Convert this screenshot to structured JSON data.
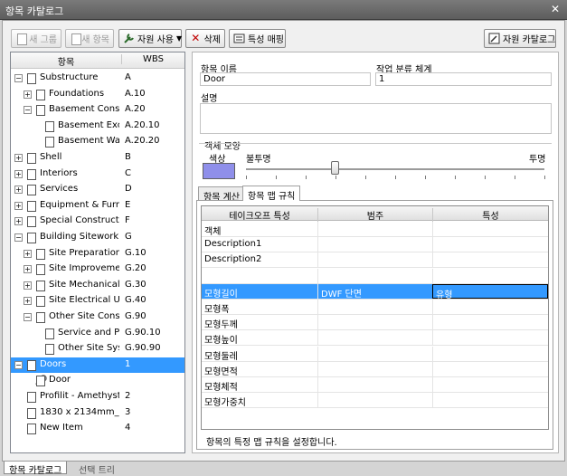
{
  "window": {
    "title": "항목 카탈로그",
    "close_glyph": "✕"
  },
  "toolbar": {
    "new_group": "새 그룹",
    "new_item": "새 항목",
    "use_resource": "자원 사용",
    "delete": "삭제",
    "property_mapping": "특성 매핑",
    "resource_catalog": "자원 카탈로그"
  },
  "tree": {
    "col_item": "항목",
    "col_wbs": "WBS",
    "rows": [
      {
        "label": "Substructure",
        "wbs": "A"
      },
      {
        "label": "Foundations",
        "wbs": "A.10"
      },
      {
        "label": "Basement Constr...",
        "wbs": "A.20"
      },
      {
        "label": "Basement Exca...",
        "wbs": "A.20.10"
      },
      {
        "label": "Basement Walls",
        "wbs": "A.20.20"
      },
      {
        "label": "Shell",
        "wbs": "B"
      },
      {
        "label": "Interiors",
        "wbs": "C"
      },
      {
        "label": "Services",
        "wbs": "D"
      },
      {
        "label": "Equipment & Furni...",
        "wbs": "E"
      },
      {
        "label": "Special Constructio...",
        "wbs": "F"
      },
      {
        "label": "Building Sitework",
        "wbs": "G"
      },
      {
        "label": "Site Preparation",
        "wbs": "G.10"
      },
      {
        "label": "Site Improvements",
        "wbs": "G.20"
      },
      {
        "label": "Site Mechanical...",
        "wbs": "G.30"
      },
      {
        "label": "Site Electrical Uti...",
        "wbs": "G.40"
      },
      {
        "label": "Other Site Const...",
        "wbs": "G.90"
      },
      {
        "label": "Service and Pe...",
        "wbs": "G.90.10"
      },
      {
        "label": "Other Site Syst...",
        "wbs": "G.90.90"
      },
      {
        "label": "Doors",
        "wbs": "1"
      },
      {
        "label": "Door",
        "wbs": ""
      },
      {
        "label": "Profilit - Amethyst",
        "wbs": "2"
      },
      {
        "label": "1830 x 2134mm_M...",
        "wbs": "3"
      },
      {
        "label": "New Item",
        "wbs": "4"
      }
    ]
  },
  "details": {
    "item_name_label": "항목 이름",
    "item_name_value": "Door",
    "wbs_label": "작업 분류 체계",
    "wbs_value": "1",
    "description_label": "설명",
    "description_value": "",
    "appearance_label": "객체 모양",
    "color_label": "색상",
    "color_value": "#8f8fea",
    "opaque_label": "불투명",
    "transparent_label": "투명",
    "transparency_level": 0.0
  },
  "tabs": {
    "calc": "항목 계산",
    "rules": "항목 맵 규칙"
  },
  "grid": {
    "headers": [
      "테이크오프 특성",
      "범주",
      "특성"
    ],
    "rows": [
      {
        "prop": "객체",
        "category": "",
        "property": ""
      },
      {
        "prop": "Description1",
        "category": "",
        "property": ""
      },
      {
        "prop": "Description2",
        "category": "",
        "property": ""
      },
      {
        "prop": "",
        "category": "",
        "property": ""
      },
      {
        "prop": "모형길이",
        "category": "DWF 단면",
        "property": "유형"
      },
      {
        "prop": "모형폭",
        "category": "",
        "property": ""
      },
      {
        "prop": "모형두께",
        "category": "",
        "property": ""
      },
      {
        "prop": "모형높이",
        "category": "",
        "property": ""
      },
      {
        "prop": "모형둘레",
        "category": "",
        "property": ""
      },
      {
        "prop": "모형면적",
        "category": "",
        "property": ""
      },
      {
        "prop": "모형체적",
        "category": "",
        "property": ""
      },
      {
        "prop": "모형가중치",
        "category": "",
        "property": ""
      }
    ],
    "status": "항목의 특정 맵 규칙을 설정합니다."
  },
  "bottom_tabs": {
    "catalog": "항목 카탈로그",
    "selection_tree": "선택 트리"
  }
}
